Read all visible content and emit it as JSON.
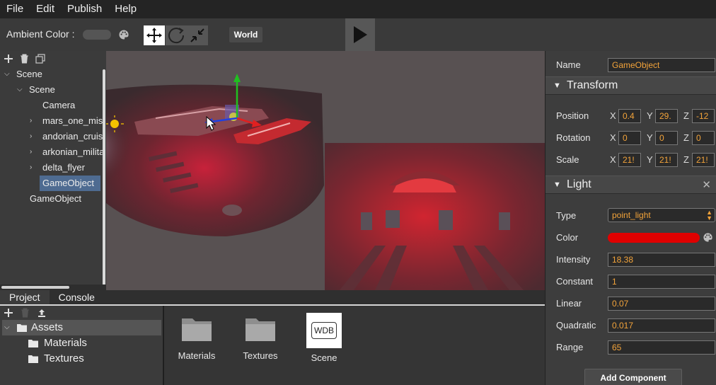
{
  "menu": [
    "File",
    "Edit",
    "Publish",
    "Help"
  ],
  "toolbar": {
    "ambient_label": "Ambient Color :",
    "world_label": "World"
  },
  "hierarchy": {
    "items": [
      {
        "label": "Scene",
        "indent": 0,
        "chev": "open"
      },
      {
        "label": "Scene",
        "indent": 1,
        "chev": "open"
      },
      {
        "label": "Camera",
        "indent": 2,
        "chev": "none"
      },
      {
        "label": "mars_one_mission",
        "indent": 2,
        "chev": "closed"
      },
      {
        "label": "andorian_cruiser",
        "indent": 2,
        "chev": "closed"
      },
      {
        "label": "arkonian_military",
        "indent": 2,
        "chev": "closed"
      },
      {
        "label": "delta_flyer",
        "indent": 2,
        "chev": "closed"
      },
      {
        "label": "GameObject",
        "indent": 2,
        "chev": "none",
        "selected": true
      },
      {
        "label": "GameObject",
        "indent": 1,
        "chev": "none"
      }
    ]
  },
  "bottom_tabs": [
    "Project",
    "Console"
  ],
  "project_tree": [
    {
      "label": "Assets",
      "selected": true
    },
    {
      "label": "Materials"
    },
    {
      "label": "Textures"
    }
  ],
  "assets": [
    {
      "label": "Materials",
      "icon": "folder-icon"
    },
    {
      "label": "Textures",
      "icon": "folder-icon"
    },
    {
      "label": "Scene",
      "icon": "wdb-file-icon",
      "badge": "WDB"
    }
  ],
  "inspector": {
    "name_label": "Name",
    "name_value": "GameObject",
    "transform_title": "Transform",
    "position_label": "Position",
    "position": {
      "x": "0.4",
      "y": "29.",
      "z": "-12"
    },
    "rotation_label": "Rotation",
    "rotation": {
      "x": "0",
      "y": "0",
      "z": "0"
    },
    "scale_label": "Scale",
    "scale": {
      "x": "21!",
      "y": "21!",
      "z": "21!"
    },
    "axis_x": "X",
    "axis_y": "Y",
    "axis_z": "Z",
    "light_title": "Light",
    "type_label": "Type",
    "type_value": "point_light",
    "color_label": "Color",
    "light_color": "#e00000",
    "intensity_label": "Intensity",
    "intensity_value": "18.38",
    "constant_label": "Constant",
    "constant_value": "1",
    "linear_label": "Linear",
    "linear_value": "0.07",
    "quadratic_label": "Quadratic",
    "quadratic_value": "0.017",
    "range_label": "Range",
    "range_value": "65",
    "add_component_label": "Add Component"
  },
  "colors": {
    "accent_orange": "#f2a33a",
    "selection_blue": "#4e6b91",
    "gizmo_x": "#e02020",
    "gizmo_y": "#20c020",
    "gizmo_z": "#2040e0"
  }
}
